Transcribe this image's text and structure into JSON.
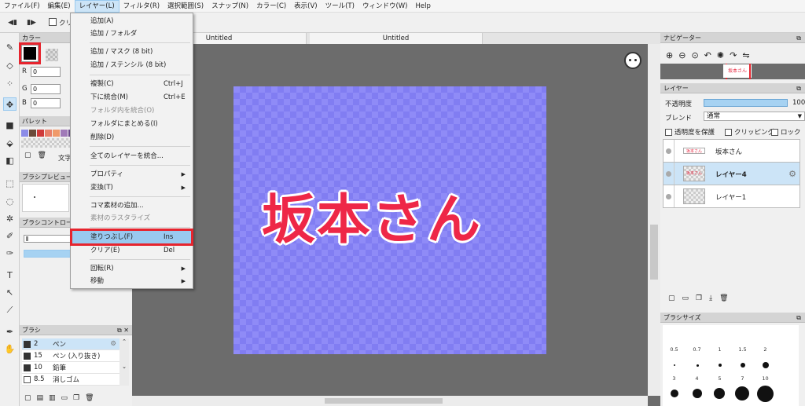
{
  "menubar": {
    "items": [
      {
        "label": "ファイル(F)"
      },
      {
        "label": "編集(E)"
      },
      {
        "label": "レイヤー(L)"
      },
      {
        "label": "フィルタ(R)"
      },
      {
        "label": "選択範囲(S)"
      },
      {
        "label": "スナップ(N)"
      },
      {
        "label": "カラー(C)"
      },
      {
        "label": "表示(V)"
      },
      {
        "label": "ツール(T)"
      },
      {
        "label": "ウィンドウ(W)"
      },
      {
        "label": "Help"
      }
    ]
  },
  "toolbar": {
    "checkbox_label": "クリ"
  },
  "layer_menu": {
    "items": [
      {
        "label": "追加(A)",
        "shortcut": "",
        "disabled": false
      },
      {
        "label": "追加 / フォルダ",
        "shortcut": "",
        "disabled": false
      },
      {
        "label": "追加 / マスク (8 bit)",
        "shortcut": "",
        "disabled": false
      },
      {
        "label": "追加 / ステンシル (8 bit)",
        "shortcut": "",
        "disabled": false
      },
      {
        "label": "複製(C)",
        "shortcut": "Ctrl+J",
        "disabled": false
      },
      {
        "label": "下に統合(M)",
        "shortcut": "Ctrl+E",
        "disabled": false
      },
      {
        "label": "フォルダ内を統合(O)",
        "shortcut": "",
        "disabled": true
      },
      {
        "label": "フォルダにまとめる(I)",
        "shortcut": "",
        "disabled": false
      },
      {
        "label": "削除(D)",
        "shortcut": "",
        "disabled": false
      },
      {
        "label": "全てのレイヤーを統合...",
        "shortcut": "",
        "disabled": false
      },
      {
        "label": "プロパティ",
        "shortcut": "",
        "disabled": false
      },
      {
        "label": "変換(T)",
        "shortcut": "",
        "disabled": false
      },
      {
        "label": "コマ素材の追加...",
        "shortcut": "",
        "disabled": false
      },
      {
        "label": "素材のラスタライズ",
        "shortcut": "",
        "disabled": true
      },
      {
        "label": "塗りつぶし(F)",
        "shortcut": "Ins",
        "disabled": false
      },
      {
        "label": "クリア(E)",
        "shortcut": "Del",
        "disabled": false
      },
      {
        "label": "回転(R)",
        "shortcut": "",
        "disabled": false
      },
      {
        "label": "移動",
        "shortcut": "",
        "disabled": false
      }
    ]
  },
  "color_panel": {
    "title": "カラー",
    "r_label": "R",
    "g_label": "G",
    "b_label": "B",
    "r": "0",
    "g": "0",
    "b": "0",
    "foreground": "#000000"
  },
  "palette_panel": {
    "title": "パレット",
    "colors": [
      "#8b8be8",
      "#6b4a3a",
      "#cf3a3a",
      "#e8806a",
      "#f09a6a",
      "#a07ab8",
      "#6a4a8a"
    ],
    "text_label": "文字"
  },
  "brush_preview_panel": {
    "title": "ブラシプレビュー"
  },
  "brush_control_panel": {
    "title": "ブラシコントロール"
  },
  "brush_panel": {
    "title": "ブラシ",
    "items": [
      {
        "size": "2",
        "name": "ペン",
        "selected": true
      },
      {
        "size": "15",
        "name": "ペン (入り抜き)",
        "selected": false
      },
      {
        "size": "10",
        "name": "鉛筆",
        "selected": false
      },
      {
        "size": "8.5",
        "name": "消しゴム",
        "selected": false
      }
    ]
  },
  "canvas": {
    "tabs": [
      "Untitled",
      "Untitled"
    ],
    "artwork_text": "坂本さん"
  },
  "navigator_panel": {
    "title": "ナビゲーター",
    "thumb_text": "坂本さん"
  },
  "layer_panel": {
    "title": "レイヤー",
    "opacity_label": "不透明度",
    "opacity_value": "100",
    "blend_label": "ブレンド",
    "blend_value": "通常",
    "protect_label": "透明度を保護",
    "clip_label": "クリッピング",
    "lock_label": "ロック",
    "layers": [
      {
        "name": "坂本さん",
        "thumb": "坂本さん"
      },
      {
        "name": "レイヤー4",
        "thumb": "坂本さん"
      },
      {
        "name": "レイヤー1",
        "thumb": ""
      }
    ]
  },
  "brush_size_panel": {
    "title": "ブラシサイズ",
    "sizes": [
      "0.5",
      "0.7",
      "1",
      "1.5",
      "2",
      "3",
      "4",
      "5",
      "7",
      "10"
    ]
  },
  "colors": {
    "accent": "#99c9ef",
    "highlight_red": "#e6242e",
    "artwork_text": "#ee2747",
    "canvas_bg": "#8f8bf7"
  }
}
